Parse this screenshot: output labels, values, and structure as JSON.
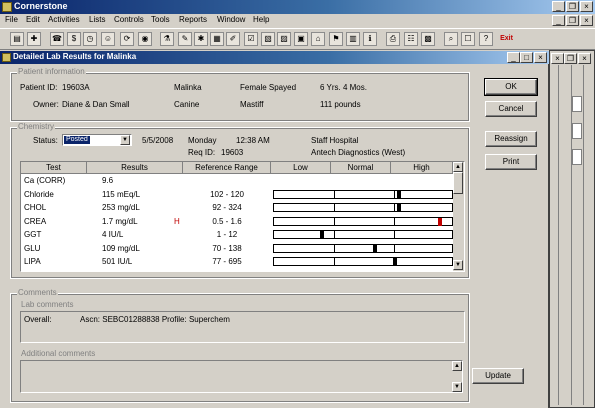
{
  "app": {
    "title": "Cornerstone"
  },
  "menu": [
    "File",
    "Edit",
    "Activities",
    "Lists",
    "Controls",
    "Tools",
    "Reports",
    "Window",
    "Help"
  ],
  "toolbar": {
    "exit_label": "Exit"
  },
  "dialog": {
    "title": "Detailed Lab Results for Malinka",
    "patient": {
      "section": "Patient information",
      "id_label": "Patient ID:",
      "id": "19603A",
      "name": "Malinka",
      "sex": "Female Spayed",
      "age": "6 Yrs. 4 Mos.",
      "owner_label": "Owner:",
      "owner": "Diane & Dan Small",
      "species": "Canine",
      "breed": "Mastiff",
      "weight": "111 pounds"
    },
    "chemistry": {
      "section": "Chemistry",
      "status_label": "Status:",
      "status": "Posted",
      "date": "5/5/2008",
      "day": "Monday",
      "time": "12:38 AM",
      "staff": "Staff Hospital",
      "req_label": "Req ID:",
      "req_id": "19603",
      "lab": "Antech Diagnostics (West)",
      "columns": [
        "Test",
        "Results",
        "Reference Range",
        "Low",
        "Normal",
        "High"
      ],
      "rows": [
        {
          "test": "Ca (CORR)",
          "result": "9.6",
          "flag": "",
          "range": ""
        },
        {
          "test": "Chloride",
          "result": "115 mEq/L",
          "flag": "",
          "range": "102 - 120",
          "level": 0.7,
          "high": false
        },
        {
          "test": "CHOL",
          "result": "253 mg/dL",
          "flag": "",
          "range": "92 - 324",
          "level": 0.7,
          "high": false
        },
        {
          "test": "CREA",
          "result": "1.7 mg/dL",
          "flag": "H",
          "range": "0.5 - 1.6",
          "level": 0.93,
          "high": true
        },
        {
          "test": "GGT",
          "result": "4 IU/L",
          "flag": "",
          "range": "1 - 12",
          "level": 0.27,
          "high": false
        },
        {
          "test": "GLU",
          "result": "109 mg/dL",
          "flag": "",
          "range": "70 - 138",
          "level": 0.57,
          "high": false
        },
        {
          "test": "LIPA",
          "result": "501 IU/L",
          "flag": "",
          "range": "77 - 695",
          "level": 0.68,
          "high": false
        }
      ]
    },
    "comments": {
      "section": "Comments",
      "lab_label": "Lab comments",
      "overall_label": "Overall:",
      "overall": "Ascn: SEBC01288838  Profile: Superchem",
      "additional_label": "Additional comments"
    },
    "buttons": {
      "ok": "OK",
      "cancel": "Cancel",
      "reassign": "Reassign",
      "print": "Print",
      "update": "Update"
    }
  }
}
